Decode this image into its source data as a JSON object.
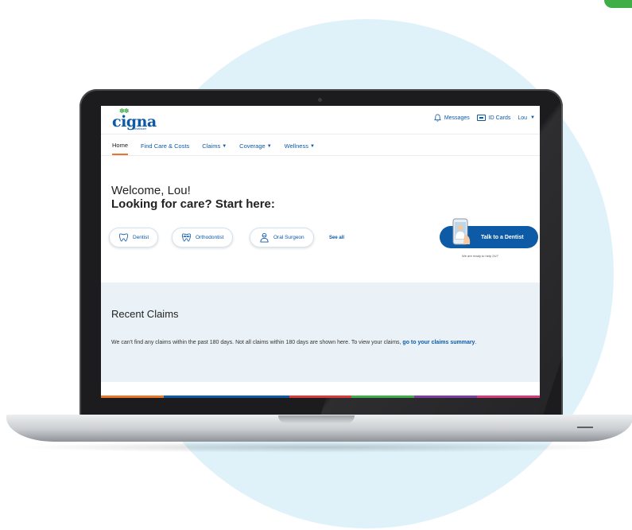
{
  "brand": {
    "logo_word": "cigna",
    "logo_sub": "healthcare",
    "primary_color": "#0d5aa7",
    "accent_color": "#e8762c",
    "leaf_color": "#3fae49"
  },
  "util_nav": {
    "messages": "Messages",
    "id_cards": "ID Cards",
    "user": "Lou"
  },
  "main_nav": [
    {
      "label": "Home"
    },
    {
      "label": "Find Care & Costs"
    },
    {
      "label": "Claims"
    },
    {
      "label": "Coverage"
    },
    {
      "label": "Wellness"
    }
  ],
  "welcome": {
    "greeting": "Welcome, Lou!",
    "headline": "Looking for care? Start here:"
  },
  "care_chips": [
    {
      "label": "Dentist",
      "icon": "tooth-icon"
    },
    {
      "label": "Orthodontist",
      "icon": "braces-tooth-icon"
    },
    {
      "label": "Oral Surgeon",
      "icon": "surgeon-icon"
    }
  ],
  "see_all": "See all",
  "talk": {
    "label": "Talk to a Dentist",
    "help": "We are ready to help 24/7"
  },
  "claims": {
    "title": "Recent Claims",
    "text": "We can't find any claims within the past 180 days. Not all claims within 180 days are shown here. To view your claims,",
    "link": "go to your claims summary",
    "end": "."
  },
  "footer_colors": [
    "#e8762c",
    "#0d5aa7",
    "#0d5aa7",
    "#d93a3a",
    "#3fae49",
    "#7a3fa1",
    "#d93a7a"
  ]
}
